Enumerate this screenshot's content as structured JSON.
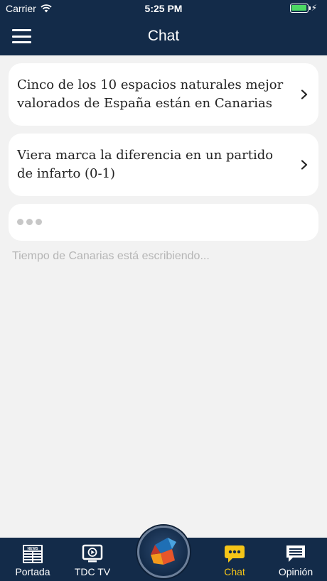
{
  "status_bar": {
    "carrier": "Carrier",
    "time": "5:25 PM"
  },
  "nav": {
    "title": "Chat"
  },
  "messages": [
    {
      "text": "Cinco de los 10 espacios naturales mejor valorados de España están en Canarias"
    },
    {
      "text": "Viera marca la diferencia en un partido de infarto (0-1)"
    }
  ],
  "typing": {
    "status": "Tiempo de Canarias está escribiendo..."
  },
  "tabs": [
    {
      "label": "Portada",
      "icon": "newspaper-icon"
    },
    {
      "label": "TDC TV",
      "icon": "tv-play-icon"
    },
    {
      "label": "Chat",
      "icon": "chat-bubble-icon",
      "active": true
    },
    {
      "label": "Opinión",
      "icon": "speech-bubble-icon"
    }
  ],
  "center_button": {
    "icon": "app-logo-icon"
  },
  "colors": {
    "header_bg": "#132b49",
    "active_tab": "#f5c518",
    "background": "#f2f2f2",
    "battery": "#4cd964"
  }
}
